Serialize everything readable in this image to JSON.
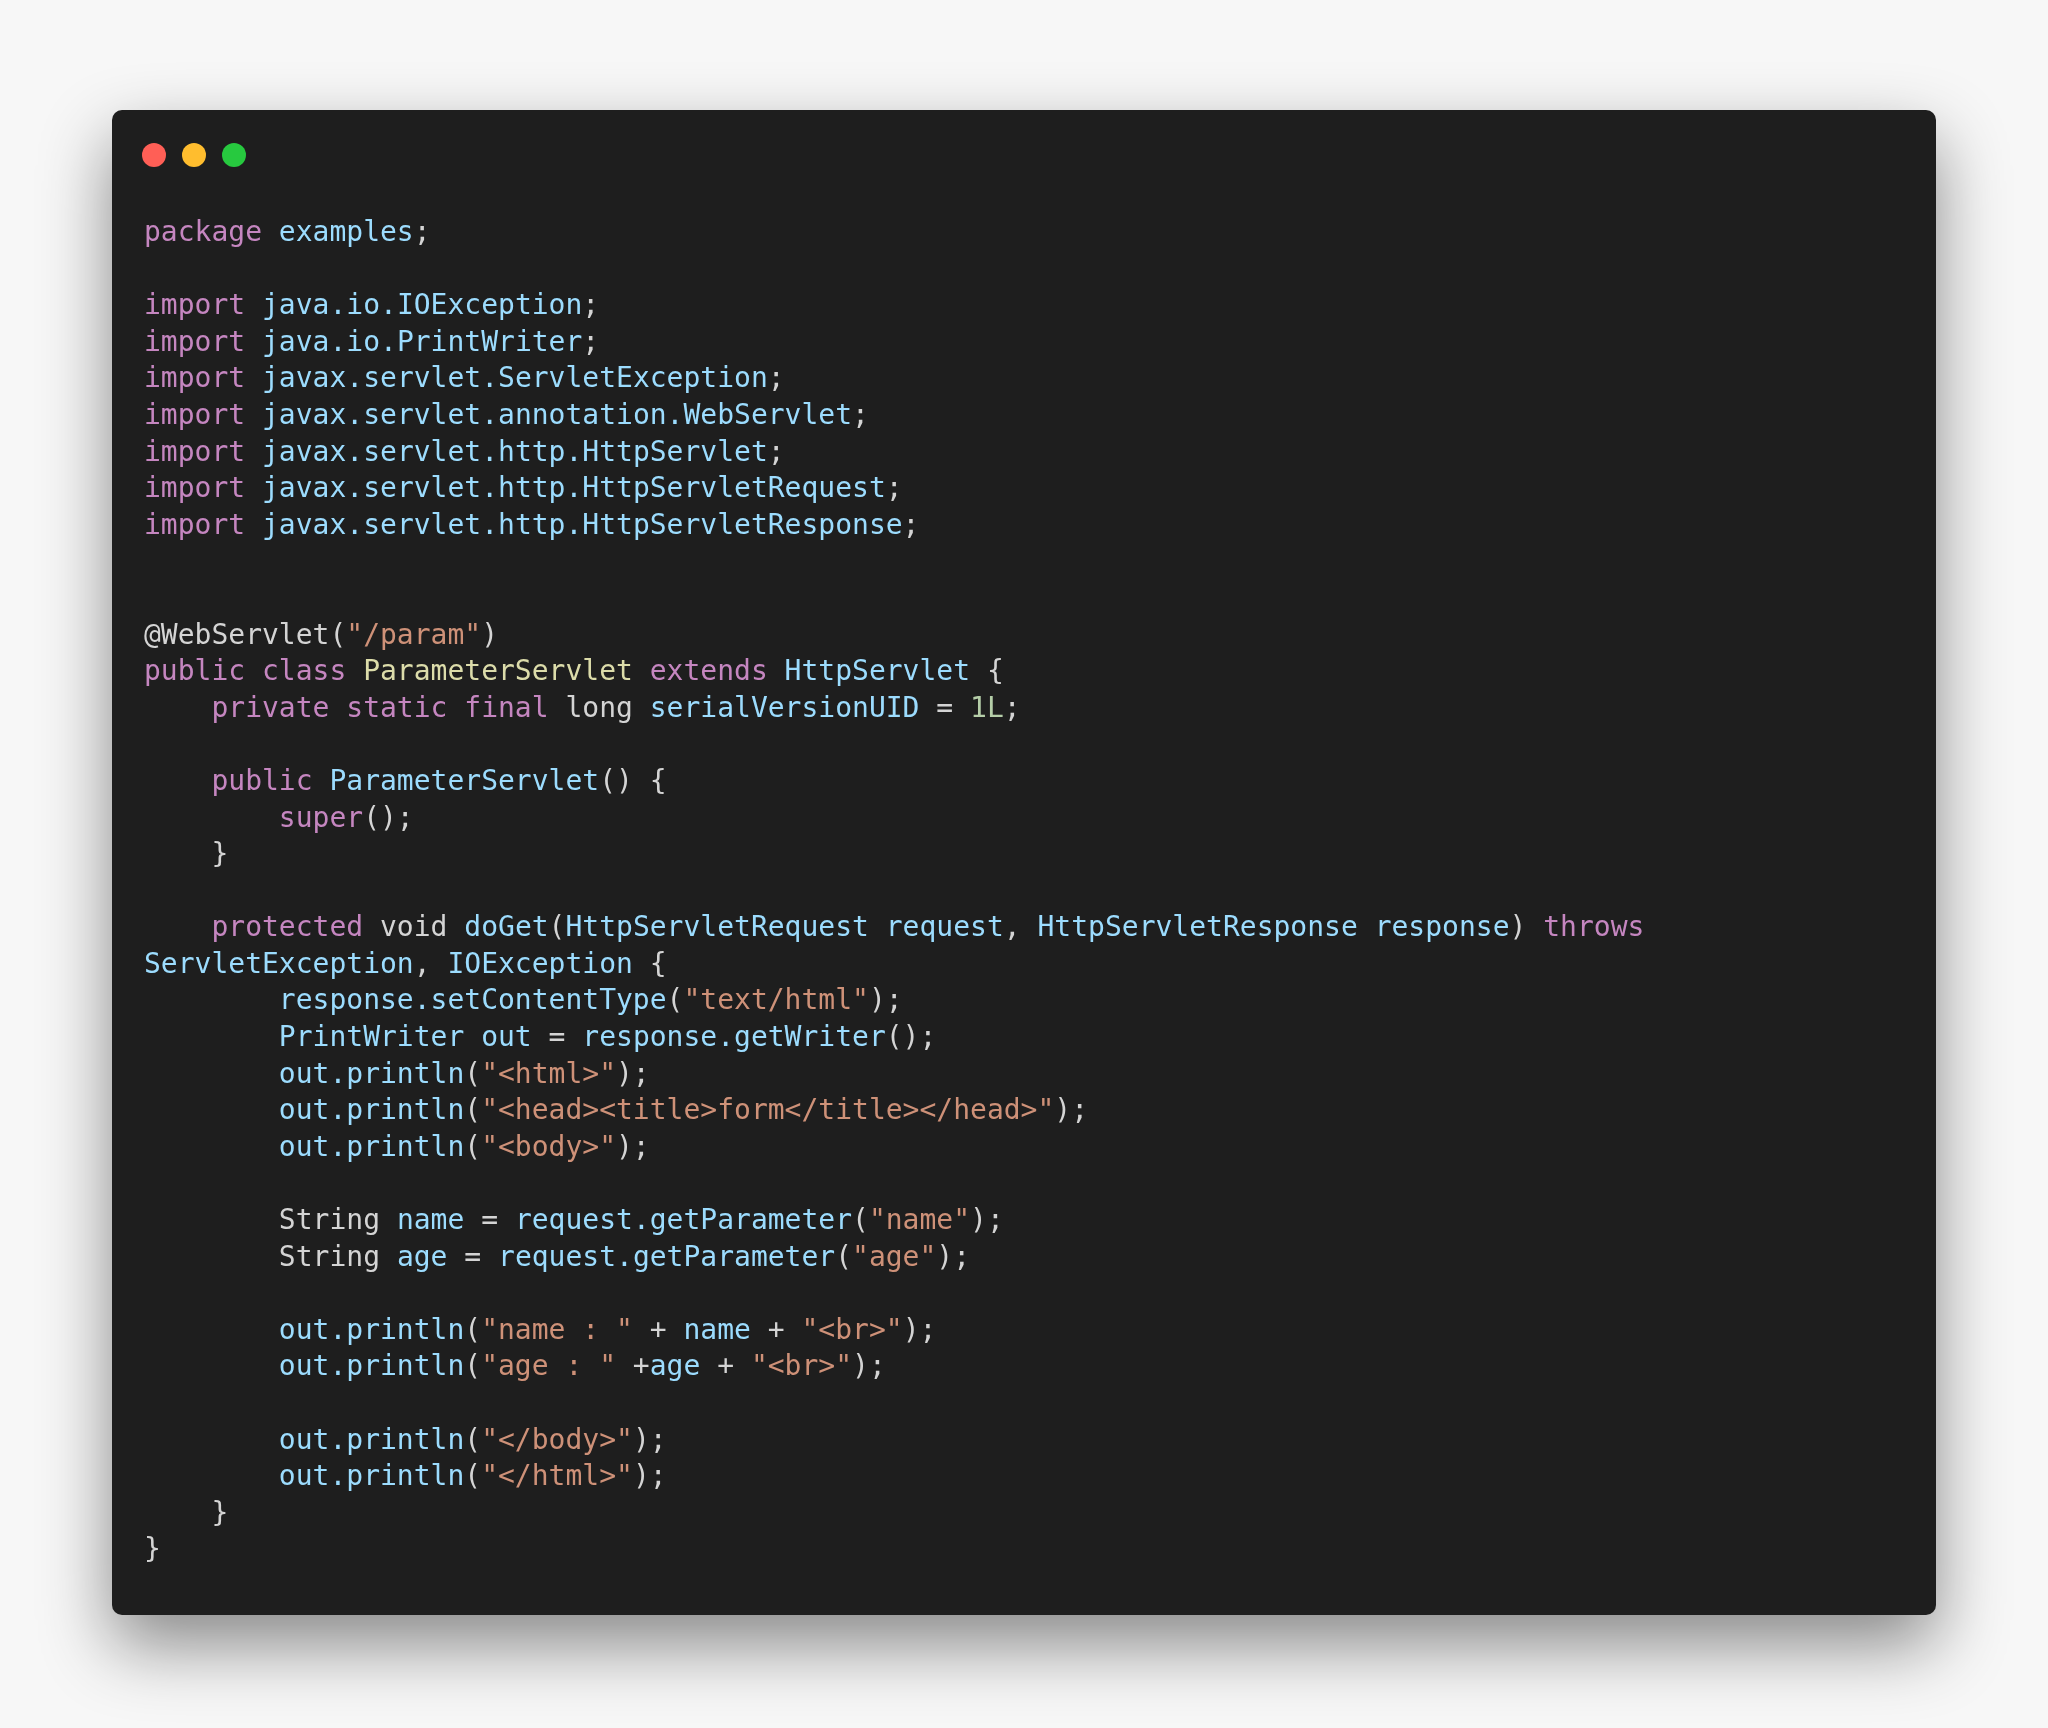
{
  "code_lines": [
    {
      "kind": "code",
      "tokens": [
        {
          "kind": "kw",
          "text": "package "
        },
        {
          "kind": "id",
          "text": "examples"
        },
        {
          "kind": "plain",
          "text": ";"
        }
      ]
    },
    {
      "kind": "blank"
    },
    {
      "kind": "code",
      "tokens": [
        {
          "kind": "kw",
          "text": "import "
        },
        {
          "kind": "id",
          "text": "java.io.IOException"
        },
        {
          "kind": "plain",
          "text": ";"
        }
      ]
    },
    {
      "kind": "code",
      "tokens": [
        {
          "kind": "kw",
          "text": "import "
        },
        {
          "kind": "id",
          "text": "java.io.PrintWriter"
        },
        {
          "kind": "plain",
          "text": ";"
        }
      ]
    },
    {
      "kind": "code",
      "tokens": [
        {
          "kind": "kw",
          "text": "import "
        },
        {
          "kind": "id",
          "text": "javax.servlet.ServletException"
        },
        {
          "kind": "plain",
          "text": ";"
        }
      ]
    },
    {
      "kind": "code",
      "tokens": [
        {
          "kind": "kw",
          "text": "import "
        },
        {
          "kind": "id",
          "text": "javax.servlet.annotation.WebServlet"
        },
        {
          "kind": "plain",
          "text": ";"
        }
      ]
    },
    {
      "kind": "code",
      "tokens": [
        {
          "kind": "kw",
          "text": "import "
        },
        {
          "kind": "id",
          "text": "javax.servlet.http.HttpServlet"
        },
        {
          "kind": "plain",
          "text": ";"
        }
      ]
    },
    {
      "kind": "code",
      "tokens": [
        {
          "kind": "kw",
          "text": "import "
        },
        {
          "kind": "id",
          "text": "javax.servlet.http.HttpServletRequest"
        },
        {
          "kind": "plain",
          "text": ";"
        }
      ]
    },
    {
      "kind": "code",
      "tokens": [
        {
          "kind": "kw",
          "text": "import "
        },
        {
          "kind": "id",
          "text": "javax.servlet.http.HttpServletResponse"
        },
        {
          "kind": "plain",
          "text": ";"
        }
      ]
    },
    {
      "kind": "blank"
    },
    {
      "kind": "blank"
    },
    {
      "kind": "code",
      "tokens": [
        {
          "kind": "plain",
          "text": "@WebServlet("
        },
        {
          "kind": "str",
          "text": "\"/param\""
        },
        {
          "kind": "plain",
          "text": ")"
        }
      ]
    },
    {
      "kind": "code",
      "tokens": [
        {
          "kind": "kw",
          "text": "public class "
        },
        {
          "kind": "cls",
          "text": "ParameterServlet "
        },
        {
          "kind": "kw",
          "text": "extends "
        },
        {
          "kind": "id",
          "text": "HttpServlet"
        },
        {
          "kind": "plain",
          "text": " {"
        }
      ]
    },
    {
      "kind": "code",
      "tokens": [
        {
          "kind": "kw",
          "text": "    private static final"
        },
        {
          "kind": "plain",
          "text": " long "
        },
        {
          "kind": "id",
          "text": "serialVersionUID"
        },
        {
          "kind": "plain",
          "text": " = "
        },
        {
          "kind": "num",
          "text": "1L"
        },
        {
          "kind": "plain",
          "text": ";"
        }
      ]
    },
    {
      "kind": "blank"
    },
    {
      "kind": "code",
      "tokens": [
        {
          "kind": "kw",
          "text": "    public "
        },
        {
          "kind": "id",
          "text": "ParameterServlet"
        },
        {
          "kind": "plain",
          "text": "() {"
        }
      ]
    },
    {
      "kind": "code",
      "tokens": [
        {
          "kind": "kw",
          "text": "        super"
        },
        {
          "kind": "plain",
          "text": "();"
        }
      ]
    },
    {
      "kind": "code",
      "tokens": [
        {
          "kind": "plain",
          "text": "    }"
        }
      ]
    },
    {
      "kind": "blank"
    },
    {
      "kind": "code",
      "tokens": [
        {
          "kind": "kw",
          "text": "    protected"
        },
        {
          "kind": "plain",
          "text": " void "
        },
        {
          "kind": "id",
          "text": "doGet"
        },
        {
          "kind": "plain",
          "text": "("
        },
        {
          "kind": "id",
          "text": "HttpServletRequest request"
        },
        {
          "kind": "plain",
          "text": ", "
        },
        {
          "kind": "id",
          "text": "HttpServletResponse response"
        },
        {
          "kind": "plain",
          "text": ") "
        },
        {
          "kind": "kw",
          "text": "throws"
        }
      ]
    },
    {
      "kind": "code",
      "tokens": [
        {
          "kind": "id",
          "text": "ServletException"
        },
        {
          "kind": "plain",
          "text": ", "
        },
        {
          "kind": "id",
          "text": "IOException"
        },
        {
          "kind": "plain",
          "text": " {"
        }
      ]
    },
    {
      "kind": "code",
      "tokens": [
        {
          "kind": "id",
          "text": "        response.setContentType"
        },
        {
          "kind": "plain",
          "text": "("
        },
        {
          "kind": "str",
          "text": "\"text/html\""
        },
        {
          "kind": "plain",
          "text": ");"
        }
      ]
    },
    {
      "kind": "code",
      "tokens": [
        {
          "kind": "id",
          "text": "        PrintWriter out"
        },
        {
          "kind": "plain",
          "text": " = "
        },
        {
          "kind": "id",
          "text": "response.getWriter"
        },
        {
          "kind": "plain",
          "text": "();"
        }
      ]
    },
    {
      "kind": "code",
      "tokens": [
        {
          "kind": "id",
          "text": "        out.println"
        },
        {
          "kind": "plain",
          "text": "("
        },
        {
          "kind": "str",
          "text": "\"<html>\""
        },
        {
          "kind": "plain",
          "text": ");"
        }
      ]
    },
    {
      "kind": "code",
      "tokens": [
        {
          "kind": "id",
          "text": "        out.println"
        },
        {
          "kind": "plain",
          "text": "("
        },
        {
          "kind": "str",
          "text": "\"<head><title>form</title></head>\""
        },
        {
          "kind": "plain",
          "text": ");"
        }
      ]
    },
    {
      "kind": "code",
      "tokens": [
        {
          "kind": "id",
          "text": "        out.println"
        },
        {
          "kind": "plain",
          "text": "("
        },
        {
          "kind": "str",
          "text": "\"<body>\""
        },
        {
          "kind": "plain",
          "text": ");"
        }
      ]
    },
    {
      "kind": "blank"
    },
    {
      "kind": "code",
      "tokens": [
        {
          "kind": "plain",
          "text": "        String "
        },
        {
          "kind": "id",
          "text": "name"
        },
        {
          "kind": "plain",
          "text": " = "
        },
        {
          "kind": "id",
          "text": "request.getParameter"
        },
        {
          "kind": "plain",
          "text": "("
        },
        {
          "kind": "str",
          "text": "\"name\""
        },
        {
          "kind": "plain",
          "text": ");"
        }
      ]
    },
    {
      "kind": "code",
      "tokens": [
        {
          "kind": "plain",
          "text": "        String "
        },
        {
          "kind": "id",
          "text": "age"
        },
        {
          "kind": "plain",
          "text": " = "
        },
        {
          "kind": "id",
          "text": "request.getParameter"
        },
        {
          "kind": "plain",
          "text": "("
        },
        {
          "kind": "str",
          "text": "\"age\""
        },
        {
          "kind": "plain",
          "text": ");"
        }
      ]
    },
    {
      "kind": "blank"
    },
    {
      "kind": "code",
      "tokens": [
        {
          "kind": "id",
          "text": "        out.println"
        },
        {
          "kind": "plain",
          "text": "("
        },
        {
          "kind": "str",
          "text": "\"name : \""
        },
        {
          "kind": "plain",
          "text": " + "
        },
        {
          "kind": "id",
          "text": "name"
        },
        {
          "kind": "plain",
          "text": " + "
        },
        {
          "kind": "str",
          "text": "\"<br>\""
        },
        {
          "kind": "plain",
          "text": ");"
        }
      ]
    },
    {
      "kind": "code",
      "tokens": [
        {
          "kind": "id",
          "text": "        out.println"
        },
        {
          "kind": "plain",
          "text": "("
        },
        {
          "kind": "str",
          "text": "\"age : \""
        },
        {
          "kind": "plain",
          "text": " +"
        },
        {
          "kind": "id",
          "text": "age"
        },
        {
          "kind": "plain",
          "text": " + "
        },
        {
          "kind": "str",
          "text": "\"<br>\""
        },
        {
          "kind": "plain",
          "text": ");"
        }
      ]
    },
    {
      "kind": "blank"
    },
    {
      "kind": "code",
      "tokens": [
        {
          "kind": "id",
          "text": "        out.println"
        },
        {
          "kind": "plain",
          "text": "("
        },
        {
          "kind": "str",
          "text": "\"</body>\""
        },
        {
          "kind": "plain",
          "text": ");"
        }
      ]
    },
    {
      "kind": "code",
      "tokens": [
        {
          "kind": "id",
          "text": "        out.println"
        },
        {
          "kind": "plain",
          "text": "("
        },
        {
          "kind": "str",
          "text": "\"</html>\""
        },
        {
          "kind": "plain",
          "text": ");"
        }
      ]
    },
    {
      "kind": "code",
      "tokens": [
        {
          "kind": "plain",
          "text": "    }"
        }
      ]
    },
    {
      "kind": "code",
      "tokens": [
        {
          "kind": "plain",
          "text": "}"
        }
      ]
    }
  ]
}
